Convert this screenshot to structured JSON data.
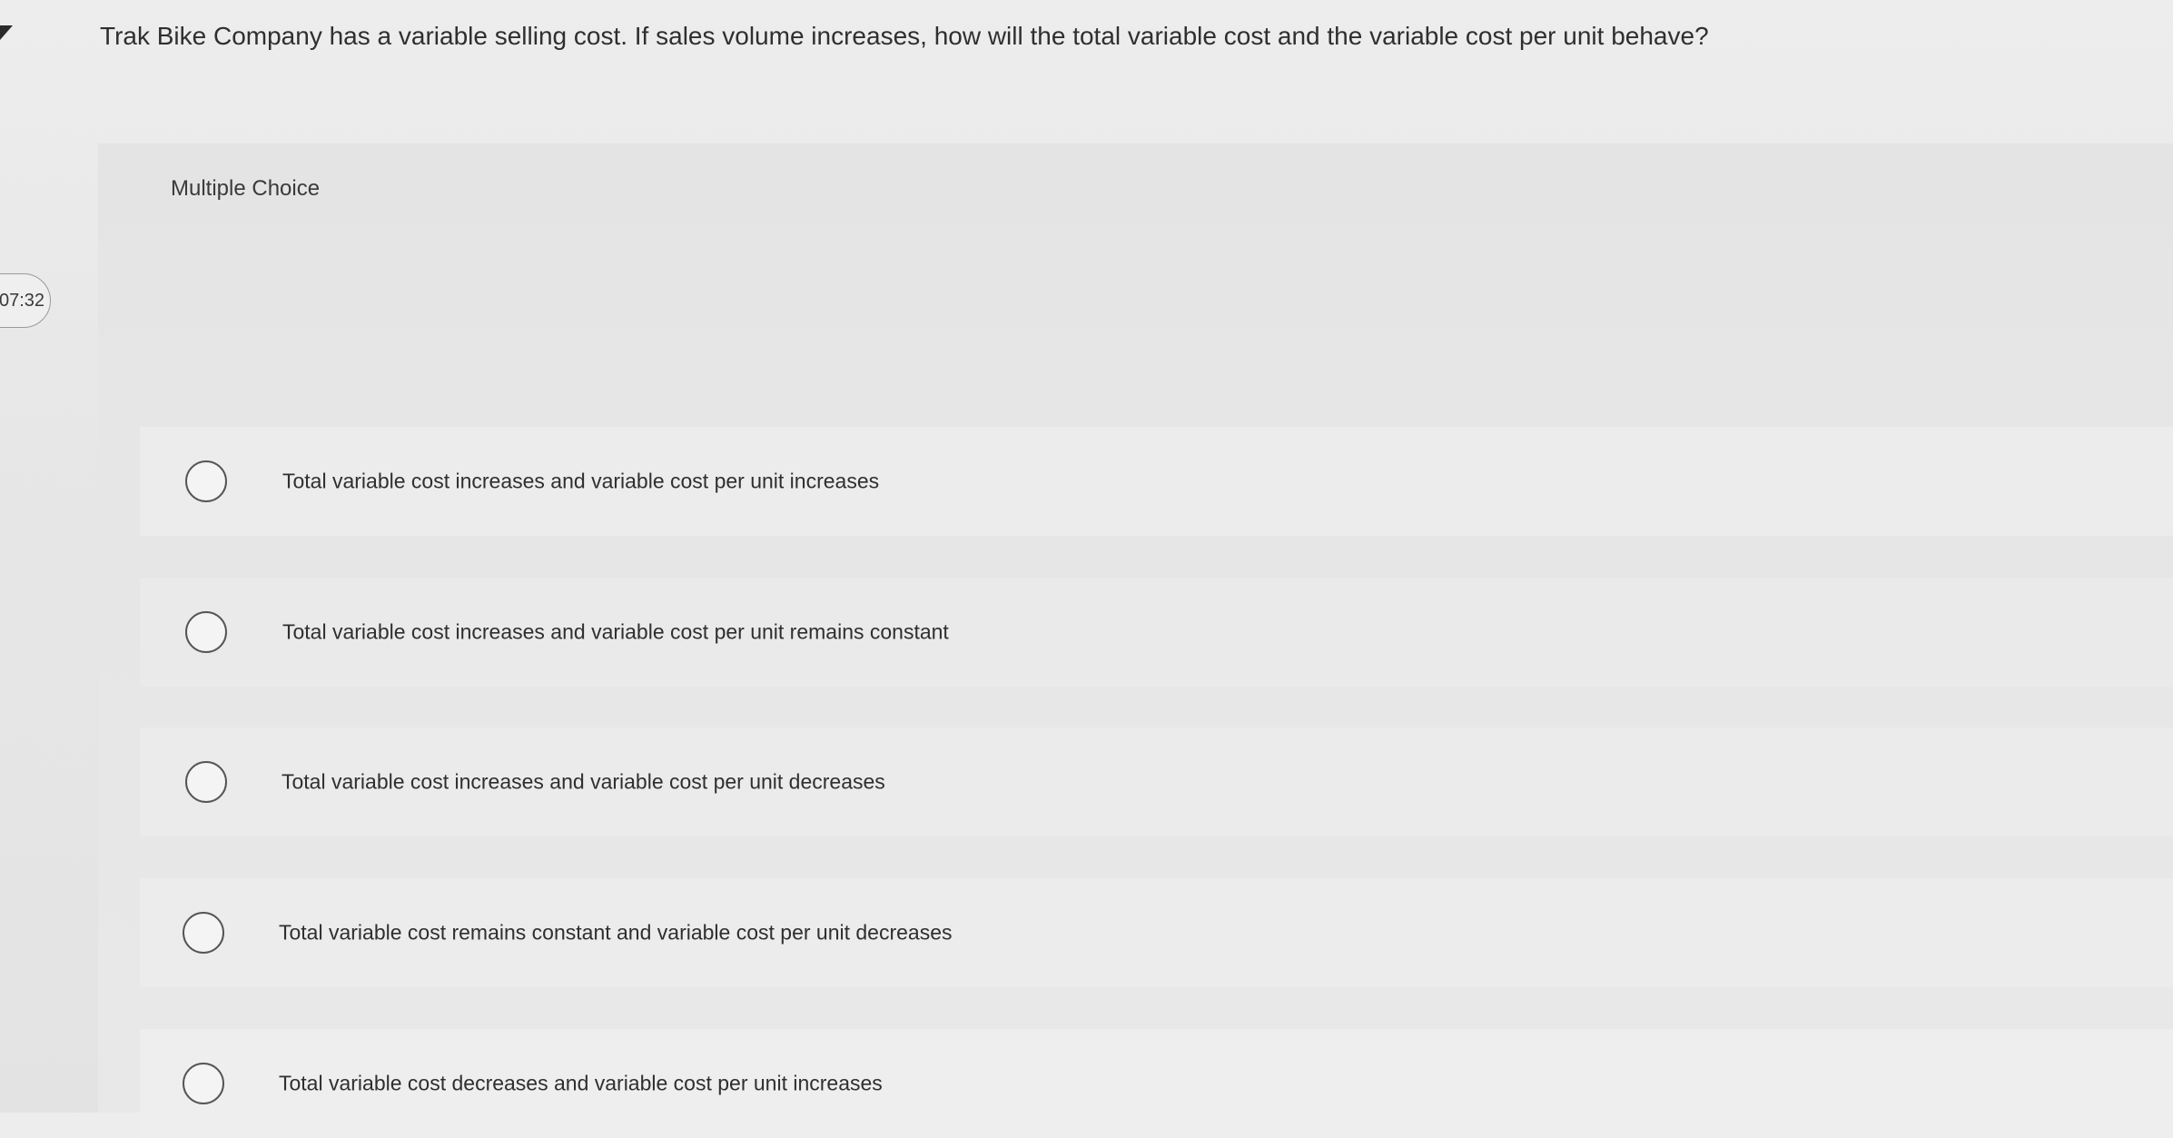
{
  "question": "Trak Bike Company has a variable selling cost. If sales volume increases, how will the total variable cost and the variable cost per unit behave?",
  "timer": "07:32",
  "panel_label": "Multiple Choice",
  "options": [
    {
      "label": "Total variable cost increases and variable cost per unit increases"
    },
    {
      "label": "Total variable cost increases and variable cost per unit remains constant"
    },
    {
      "label": "Total variable cost increases and variable cost per unit decreases"
    },
    {
      "label": "Total variable cost remains constant and variable cost per unit decreases"
    },
    {
      "label": "Total variable cost decreases and variable cost per unit increases"
    }
  ]
}
